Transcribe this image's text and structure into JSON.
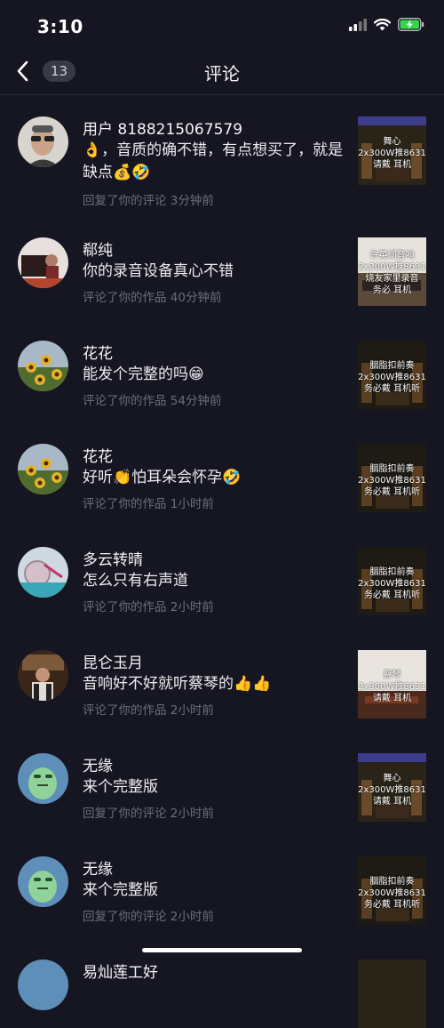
{
  "status": {
    "time": "3:10"
  },
  "nav": {
    "back_count": "13",
    "title": "评论"
  },
  "comments": [
    {
      "name": "用户 8188215067579",
      "text": "👌，音质的确不错，有点想买了，就是缺点💰🤣",
      "meta": "回复了你的评论 3分钟前",
      "thumb": "舞心\n2x300W推8631\n请戴 耳机"
    },
    {
      "name": "郗纯",
      "text": "你的录音设备真心不错",
      "meta": "评论了你的作品 40分钟前",
      "thumb": "许英词音响\n2x300W推8631\n烧友家里录音\n务必 耳机"
    },
    {
      "name": "花花",
      "text": "能发个完整的吗😁",
      "meta": "评论了你的作品 54分钟前",
      "thumb": "胭脂扣前奏\n2x300W推8631\n务必戴 耳机听"
    },
    {
      "name": "花花",
      "text": "好听👏怕耳朵会怀孕🤣",
      "meta": "评论了你的作品 1小时前",
      "thumb": "胭脂扣前奏\n2x300W推8631\n务必戴 耳机听"
    },
    {
      "name": "多云转晴",
      "text": "怎么只有右声道",
      "meta": "评论了你的作品 2小时前",
      "thumb": "胭脂扣前奏\n2x300W推8631\n务必戴 耳机听"
    },
    {
      "name": "昆仑玉月",
      "text": "音响好不好就听蔡琴的👍👍",
      "meta": "评论了你的作品 2小时前",
      "thumb": "蔡琴\n2x300W推8631\n请戴 耳机"
    },
    {
      "name": "无缘",
      "text": "来个完整版",
      "meta": "回复了你的评论 2小时前",
      "thumb": "舞心\n2x300W推8631\n请戴 耳机"
    },
    {
      "name": "无缘",
      "text": "来个完整版",
      "meta": "回复了你的评论 2小时前",
      "thumb": "胭脂扣前奏\n2x300W推8631\n务必戴 耳机听"
    }
  ],
  "partial_row_name": "易灿莲工好"
}
